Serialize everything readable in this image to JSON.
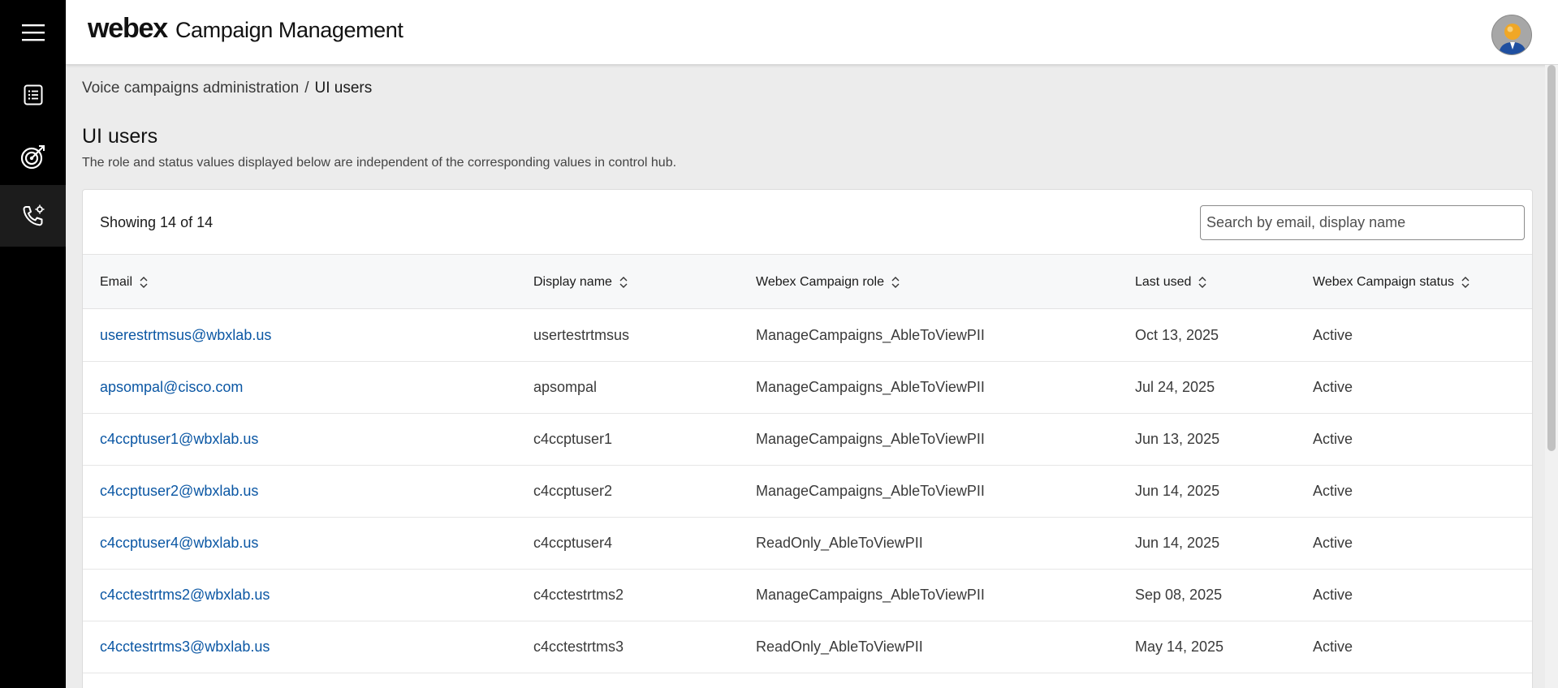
{
  "header": {
    "brand": "webex",
    "app_title": "Campaign Management"
  },
  "rail": {
    "items": [
      {
        "icon": "menu-icon"
      },
      {
        "icon": "list-document-icon"
      },
      {
        "icon": "target-icon"
      },
      {
        "icon": "phone-settings-icon"
      }
    ]
  },
  "breadcrumb": {
    "parent": "Voice campaigns administration",
    "separator": "/",
    "current": "UI users"
  },
  "page": {
    "title": "UI users",
    "subtitle": "The role and status values displayed below are independent of the corresponding values in control hub."
  },
  "table": {
    "showing": "Showing 14 of 14",
    "search_placeholder": "Search by email, display name",
    "columns": [
      "Email",
      "Display name",
      "Webex Campaign role",
      "Last used",
      "Webex Campaign status"
    ],
    "rows": [
      {
        "email": "userestrtmsus@wbxlab.us",
        "display_name": "usertestrtmsus",
        "role": "ManageCampaigns_AbleToViewPII",
        "last_used": "Oct 13, 2025",
        "status": "Active"
      },
      {
        "email": "apsompal@cisco.com",
        "display_name": "apsompal",
        "role": "ManageCampaigns_AbleToViewPII",
        "last_used": "Jul 24, 2025",
        "status": "Active"
      },
      {
        "email": "c4ccptuser1@wbxlab.us",
        "display_name": "c4ccptuser1",
        "role": "ManageCampaigns_AbleToViewPII",
        "last_used": "Jun 13, 2025",
        "status": "Active"
      },
      {
        "email": "c4ccptuser2@wbxlab.us",
        "display_name": "c4ccptuser2",
        "role": "ManageCampaigns_AbleToViewPII",
        "last_used": "Jun 14, 2025",
        "status": "Active"
      },
      {
        "email": "c4ccptuser4@wbxlab.us",
        "display_name": "c4ccptuser4",
        "role": "ReadOnly_AbleToViewPII",
        "last_used": "Jun 14, 2025",
        "status": "Active"
      },
      {
        "email": "c4cctestrtms2@wbxlab.us",
        "display_name": "c4cctestrtms2",
        "role": "ManageCampaigns_AbleToViewPII",
        "last_used": "Sep 08, 2025",
        "status": "Active"
      },
      {
        "email": "c4cctestrtms3@wbxlab.us",
        "display_name": "c4cctestrtms3",
        "role": "ReadOnly_AbleToViewPII",
        "last_used": "May 14, 2025",
        "status": "Active"
      }
    ]
  },
  "colors": {
    "link": "#0b57a4",
    "rail": "#000000",
    "background": "#ececec"
  }
}
